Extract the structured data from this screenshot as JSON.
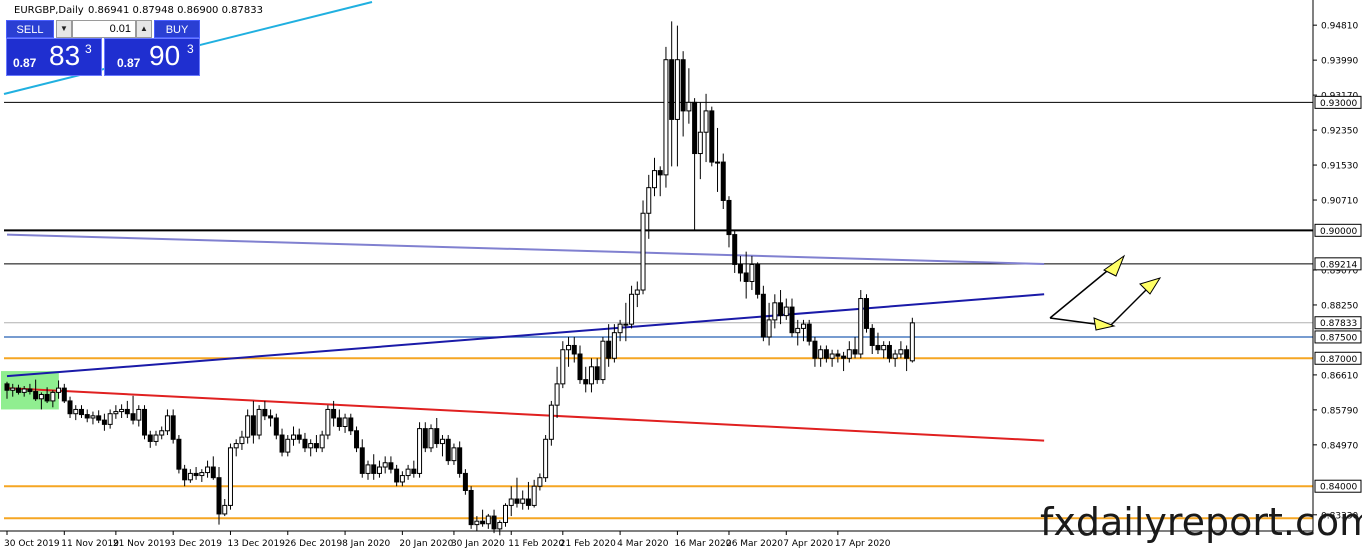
{
  "header": {
    "symbol": "EURGBP,Daily",
    "ohlc": "0.86941 0.87948 0.86900 0.87833"
  },
  "trade_panel": {
    "sell_label": "SELL",
    "buy_label": "BUY",
    "lot": "0.01",
    "bid_prefix": "0.87",
    "bid_big": "83",
    "bid_sup": "3",
    "ask_prefix": "0.87",
    "ask_big": "90",
    "ask_sup": "3"
  },
  "watermark": "fxdailyreport.com",
  "colors": {
    "axis_text": "#000000",
    "grid": "#000000",
    "orange_line": "#f5a623",
    "red_line": "#e02020",
    "blue_line": "#1a1aa8",
    "purple_line": "#8080d0",
    "steel_line": "#4a7cc0",
    "gray_line": "#b0b0b0",
    "cyan_line": "#20b0e0",
    "green_box": "#90ee90",
    "arrow_fill": "#ffff66"
  },
  "chart_data": {
    "type": "candlestick",
    "symbol": "EURGBP",
    "timeframe": "Daily",
    "ylim": [
      0.8295,
      0.954
    ],
    "y_ticks": [
      "0.94810",
      "0.93990",
      "0.93170",
      "0.92350",
      "0.91530",
      "0.90710",
      "0.89070",
      "0.88250",
      "0.86610",
      "0.85790",
      "0.84970",
      "0.83330"
    ],
    "price_tags": [
      {
        "label": "0.93000",
        "value": 0.93
      },
      {
        "label": "0.90000",
        "value": 0.9
      },
      {
        "label": "0.89214",
        "value": 0.89214
      },
      {
        "label": "0.87833",
        "value": 0.87833
      },
      {
        "label": "0.87500",
        "value": 0.875
      },
      {
        "label": "0.87000",
        "value": 0.87
      },
      {
        "label": "0.84000",
        "value": 0.84
      }
    ],
    "x_labels": [
      "30 Oct 2019",
      "11 Nov 2019",
      "21 Nov 2019",
      "3 Dec 2019",
      "13 Dec 2019",
      "26 Dec 2019",
      "8 Jan 2020",
      "20 Jan 2020",
      "30 Jan 2020",
      "11 Feb 2020",
      "21 Feb 2020",
      "4 Mar 2020",
      "16 Mar 2020",
      "26 Mar 2020",
      "7 Apr 2020",
      "17 Apr 2020"
    ],
    "horizontal_levels": [
      {
        "value": 0.93,
        "style": "black"
      },
      {
        "value": 0.9,
        "style": "black-thick"
      },
      {
        "value": 0.89214,
        "style": "black"
      },
      {
        "value": 0.87833,
        "style": "gray"
      },
      {
        "value": 0.875,
        "style": "steel"
      },
      {
        "value": 0.87,
        "style": "orange"
      },
      {
        "value": 0.84,
        "style": "orange"
      },
      {
        "value": 0.8325,
        "style": "orange"
      }
    ],
    "trendlines": [
      {
        "style": "red",
        "from": [
          0,
          0.863
        ],
        "to": [
          181,
          0.8507
        ]
      },
      {
        "style": "blue",
        "from": [
          0,
          0.8658
        ],
        "to": [
          181,
          0.885
        ]
      },
      {
        "style": "purple",
        "from": [
          0,
          0.899
        ],
        "to": [
          181,
          0.8921
        ]
      }
    ],
    "candles": [
      [
        0.864,
        0.8645,
        0.8605,
        0.8625
      ],
      [
        0.8625,
        0.864,
        0.861,
        0.863
      ],
      [
        0.863,
        0.8638,
        0.8615,
        0.862
      ],
      [
        0.862,
        0.8635,
        0.861,
        0.8628
      ],
      [
        0.8628,
        0.864,
        0.8615,
        0.8622
      ],
      [
        0.8622,
        0.865,
        0.86,
        0.8605
      ],
      [
        0.8605,
        0.862,
        0.858,
        0.8615
      ],
      [
        0.8615,
        0.8632,
        0.8595,
        0.86
      ],
      [
        0.86,
        0.8625,
        0.8585,
        0.862
      ],
      [
        0.862,
        0.8648,
        0.8605,
        0.863
      ],
      [
        0.863,
        0.864,
        0.8595,
        0.86
      ],
      [
        0.86,
        0.861,
        0.856,
        0.857
      ],
      [
        0.857,
        0.859,
        0.8555,
        0.858
      ],
      [
        0.858,
        0.859,
        0.856,
        0.8568
      ],
      [
        0.8568,
        0.858,
        0.855,
        0.856
      ],
      [
        0.856,
        0.8575,
        0.8545,
        0.8565
      ],
      [
        0.8565,
        0.8578,
        0.8548,
        0.8555
      ],
      [
        0.8555,
        0.857,
        0.853,
        0.8545
      ],
      [
        0.8545,
        0.858,
        0.8535,
        0.857
      ],
      [
        0.857,
        0.859,
        0.8558,
        0.8575
      ],
      [
        0.8575,
        0.8592,
        0.856,
        0.858
      ],
      [
        0.858,
        0.86,
        0.856,
        0.857
      ],
      [
        0.857,
        0.8612,
        0.8545,
        0.8555
      ],
      [
        0.8555,
        0.859,
        0.854,
        0.858
      ],
      [
        0.858,
        0.859,
        0.851,
        0.852
      ],
      [
        0.852,
        0.853,
        0.849,
        0.8505
      ],
      [
        0.8505,
        0.853,
        0.8495,
        0.852
      ],
      [
        0.852,
        0.854,
        0.851,
        0.853
      ],
      [
        0.853,
        0.858,
        0.852,
        0.8565
      ],
      [
        0.8565,
        0.858,
        0.85,
        0.851
      ],
      [
        0.851,
        0.852,
        0.843,
        0.844
      ],
      [
        0.844,
        0.845,
        0.84,
        0.8415
      ],
      [
        0.8415,
        0.844,
        0.8408,
        0.843
      ],
      [
        0.843,
        0.8445,
        0.8415,
        0.8425
      ],
      [
        0.8425,
        0.844,
        0.841,
        0.8432
      ],
      [
        0.8432,
        0.846,
        0.842,
        0.8445
      ],
      [
        0.8445,
        0.847,
        0.8415,
        0.842
      ],
      [
        0.842,
        0.8445,
        0.831,
        0.8335
      ],
      [
        0.8335,
        0.837,
        0.833,
        0.8355
      ],
      [
        0.8355,
        0.85,
        0.8345,
        0.849
      ],
      [
        0.849,
        0.851,
        0.847,
        0.85
      ],
      [
        0.85,
        0.853,
        0.8485,
        0.8515
      ],
      [
        0.8515,
        0.858,
        0.85,
        0.8565
      ],
      [
        0.8565,
        0.86,
        0.85,
        0.852
      ],
      [
        0.852,
        0.859,
        0.851,
        0.858
      ],
      [
        0.858,
        0.86,
        0.8555,
        0.8565
      ],
      [
        0.8565,
        0.858,
        0.854,
        0.856
      ],
      [
        0.856,
        0.857,
        0.851,
        0.852
      ],
      [
        0.852,
        0.8535,
        0.847,
        0.848
      ],
      [
        0.848,
        0.852,
        0.847,
        0.851
      ],
      [
        0.851,
        0.854,
        0.8495,
        0.852
      ],
      [
        0.852,
        0.8535,
        0.85,
        0.851
      ],
      [
        0.851,
        0.8525,
        0.848,
        0.849
      ],
      [
        0.849,
        0.851,
        0.847,
        0.85
      ],
      [
        0.85,
        0.852,
        0.848,
        0.849
      ],
      [
        0.849,
        0.853,
        0.848,
        0.852
      ],
      [
        0.852,
        0.859,
        0.851,
        0.858
      ],
      [
        0.858,
        0.86,
        0.854,
        0.856
      ],
      [
        0.856,
        0.858,
        0.853,
        0.854
      ],
      [
        0.854,
        0.857,
        0.8525,
        0.856
      ],
      [
        0.856,
        0.857,
        0.852,
        0.853
      ],
      [
        0.853,
        0.854,
        0.848,
        0.849
      ],
      [
        0.849,
        0.851,
        0.842,
        0.843
      ],
      [
        0.843,
        0.846,
        0.8415,
        0.845
      ],
      [
        0.845,
        0.8475,
        0.8415,
        0.843
      ],
      [
        0.843,
        0.846,
        0.842,
        0.8445
      ],
      [
        0.8445,
        0.847,
        0.843,
        0.8455
      ],
      [
        0.8455,
        0.847,
        0.843,
        0.844
      ],
      [
        0.844,
        0.845,
        0.84,
        0.841
      ],
      [
        0.841,
        0.8435,
        0.84,
        0.8425
      ],
      [
        0.8425,
        0.845,
        0.8415,
        0.844
      ],
      [
        0.844,
        0.846,
        0.842,
        0.843
      ],
      [
        0.843,
        0.855,
        0.842,
        0.8535
      ],
      [
        0.8535,
        0.855,
        0.848,
        0.849
      ],
      [
        0.849,
        0.8545,
        0.848,
        0.8535
      ],
      [
        0.8535,
        0.856,
        0.849,
        0.85
      ],
      [
        0.85,
        0.852,
        0.847,
        0.851
      ],
      [
        0.851,
        0.852,
        0.845,
        0.846
      ],
      [
        0.846,
        0.85,
        0.845,
        0.849
      ],
      [
        0.849,
        0.8505,
        0.842,
        0.843
      ],
      [
        0.843,
        0.844,
        0.838,
        0.839
      ],
      [
        0.839,
        0.84,
        0.83,
        0.831
      ],
      [
        0.831,
        0.833,
        0.8295,
        0.8318
      ],
      [
        0.8318,
        0.8345,
        0.8305,
        0.8312
      ],
      [
        0.8312,
        0.8335,
        0.83,
        0.833
      ],
      [
        0.833,
        0.8345,
        0.829,
        0.83
      ],
      [
        0.83,
        0.832,
        0.8285,
        0.8315
      ],
      [
        0.8315,
        0.836,
        0.8305,
        0.8355
      ],
      [
        0.8355,
        0.84,
        0.833,
        0.837
      ],
      [
        0.837,
        0.842,
        0.835,
        0.836
      ],
      [
        0.836,
        0.839,
        0.8345,
        0.837
      ],
      [
        0.837,
        0.841,
        0.8345,
        0.8355
      ],
      [
        0.8355,
        0.8415,
        0.835,
        0.84
      ],
      [
        0.84,
        0.843,
        0.839,
        0.842
      ],
      [
        0.842,
        0.852,
        0.841,
        0.851
      ],
      [
        0.851,
        0.86,
        0.8495,
        0.859
      ],
      [
        0.859,
        0.868,
        0.856,
        0.864
      ],
      [
        0.864,
        0.874,
        0.863,
        0.872
      ],
      [
        0.872,
        0.875,
        0.868,
        0.873
      ],
      [
        0.873,
        0.875,
        0.869,
        0.871
      ],
      [
        0.871,
        0.873,
        0.864,
        0.865
      ],
      [
        0.865,
        0.868,
        0.862,
        0.864
      ],
      [
        0.864,
        0.87,
        0.862,
        0.868
      ],
      [
        0.868,
        0.87,
        0.864,
        0.865
      ],
      [
        0.865,
        0.875,
        0.864,
        0.874
      ],
      [
        0.874,
        0.878,
        0.868,
        0.87
      ],
      [
        0.87,
        0.878,
        0.869,
        0.876
      ],
      [
        0.876,
        0.879,
        0.874,
        0.878
      ],
      [
        0.878,
        0.883,
        0.874,
        0.878
      ],
      [
        0.878,
        0.887,
        0.877,
        0.885
      ],
      [
        0.885,
        0.888,
        0.882,
        0.886
      ],
      [
        0.886,
        0.907,
        0.885,
        0.904
      ],
      [
        0.904,
        0.913,
        0.898,
        0.91
      ],
      [
        0.91,
        0.917,
        0.908,
        0.914
      ],
      [
        0.914,
        0.915,
        0.908,
        0.913
      ],
      [
        0.913,
        0.943,
        0.91,
        0.94
      ],
      [
        0.94,
        0.949,
        0.915,
        0.926
      ],
      [
        0.926,
        0.948,
        0.915,
        0.94
      ],
      [
        0.94,
        0.942,
        0.922,
        0.928
      ],
      [
        0.928,
        0.938,
        0.925,
        0.93
      ],
      [
        0.93,
        0.931,
        0.9,
        0.918
      ],
      [
        0.918,
        0.93,
        0.912,
        0.923
      ],
      [
        0.923,
        0.932,
        0.916,
        0.928
      ],
      [
        0.928,
        0.929,
        0.915,
        0.916
      ],
      [
        0.916,
        0.924,
        0.909,
        0.916
      ],
      [
        0.916,
        0.918,
        0.905,
        0.907
      ],
      [
        0.907,
        0.908,
        0.896,
        0.899
      ],
      [
        0.899,
        0.9,
        0.89,
        0.892
      ],
      [
        0.892,
        0.894,
        0.888,
        0.89
      ],
      [
        0.89,
        0.895,
        0.884,
        0.888
      ],
      [
        0.888,
        0.894,
        0.886,
        0.892
      ],
      [
        0.892,
        0.8925,
        0.884,
        0.885
      ],
      [
        0.885,
        0.887,
        0.874,
        0.875
      ],
      [
        0.875,
        0.883,
        0.873,
        0.879
      ],
      [
        0.879,
        0.885,
        0.877,
        0.883
      ],
      [
        0.883,
        0.886,
        0.878,
        0.88
      ],
      [
        0.88,
        0.884,
        0.879,
        0.882
      ],
      [
        0.882,
        0.884,
        0.875,
        0.876
      ],
      [
        0.876,
        0.879,
        0.873,
        0.877
      ],
      [
        0.877,
        0.879,
        0.874,
        0.878
      ],
      [
        0.878,
        0.879,
        0.873,
        0.874
      ],
      [
        0.874,
        0.875,
        0.868,
        0.87
      ],
      [
        0.87,
        0.873,
        0.868,
        0.872
      ],
      [
        0.872,
        0.873,
        0.869,
        0.87
      ],
      [
        0.87,
        0.872,
        0.868,
        0.871
      ],
      [
        0.871,
        0.872,
        0.869,
        0.8705
      ],
      [
        0.8705,
        0.8715,
        0.867,
        0.87
      ],
      [
        0.87,
        0.874,
        0.869,
        0.872
      ],
      [
        0.872,
        0.875,
        0.87,
        0.871
      ],
      [
        0.871,
        0.886,
        0.87,
        0.884
      ],
      [
        0.884,
        0.885,
        0.876,
        0.877
      ],
      [
        0.877,
        0.878,
        0.871,
        0.873
      ],
      [
        0.873,
        0.876,
        0.871,
        0.872
      ],
      [
        0.872,
        0.874,
        0.87,
        0.873
      ],
      [
        0.873,
        0.874,
        0.869,
        0.87
      ],
      [
        0.87,
        0.872,
        0.868,
        0.871
      ],
      [
        0.871,
        0.874,
        0.87,
        0.872
      ],
      [
        0.872,
        0.873,
        0.867,
        0.87
      ],
      [
        0.8694,
        0.8795,
        0.869,
        0.8783
      ]
    ],
    "green_zone": {
      "from_index": 0,
      "to_index": 8,
      "low": 0.858,
      "high": 0.867
    }
  }
}
